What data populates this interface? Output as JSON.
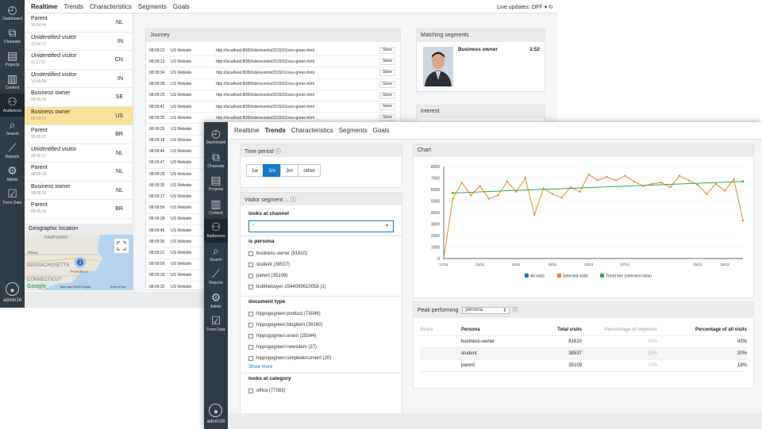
{
  "sidebar": {
    "items": [
      {
        "label": "Dashboard",
        "icon": "gauge-icon"
      },
      {
        "label": "Channels",
        "icon": "channels-icon"
      },
      {
        "label": "Projects",
        "icon": "clipboard-icon"
      },
      {
        "label": "Content",
        "icon": "document-icon"
      },
      {
        "label": "Audiences",
        "icon": "audiences-icon"
      },
      {
        "label": "Search",
        "icon": "search-icon"
      },
      {
        "label": "Reports",
        "icon": "chart-icon"
      },
      {
        "label": "Admin",
        "icon": "gear-icon"
      },
      {
        "label": "Form Data",
        "icon": "checkbox-icon"
      }
    ],
    "user": "admin16"
  },
  "back": {
    "tabs": [
      "Realtime",
      "Trends",
      "Characteristics",
      "Segments",
      "Goals"
    ],
    "live": "Live updates: OFF",
    "visitors": [
      {
        "name": "Parent",
        "time": "14:14:44",
        "country": "NL",
        "italic": false
      },
      {
        "name": "Unidentified visitor",
        "time": "12:04:17",
        "country": "IN",
        "italic": true
      },
      {
        "name": "Unidentified visitor",
        "time": "11:57:37",
        "country": "CN",
        "italic": true
      },
      {
        "name": "Unidentified visitor",
        "time": "10:40:58",
        "country": "IN",
        "italic": true
      },
      {
        "name": "Business owner",
        "time": "08:09:25",
        "country": "SE",
        "italic": false
      },
      {
        "name": "Business owner",
        "time": "08:09:22",
        "country": "US",
        "italic": false
      },
      {
        "name": "Parent",
        "time": "08:05:22",
        "country": "BR",
        "italic": false
      },
      {
        "name": "Unidentified visitor",
        "time": "08:05:17",
        "country": "NL",
        "italic": true
      },
      {
        "name": "Parent",
        "time": "08:05:16",
        "country": "NL",
        "italic": false
      },
      {
        "name": "Business owner",
        "time": "08:05:16",
        "country": "NL",
        "italic": false
      },
      {
        "name": "Parent",
        "time": "08:05:15",
        "country": "BR",
        "italic": false
      }
    ],
    "geo": {
      "title": "Geographic location",
      "labels": [
        "Albany",
        "HAMPSHIRE",
        "MASSACHUSETTS",
        "Providence",
        "CONNECTICUT"
      ],
      "marker": "3",
      "footer": "Map data ©2018 Google",
      "terms": "Terms of Use",
      "google": "Google"
    },
    "journey": {
      "title": "Journey",
      "rows": [
        {
          "time": "08:09:22",
          "site": "US Website",
          "url": "http://localhost:8080/site/events/2015/01/ces-green.html",
          "tag": "Store"
        },
        {
          "time": "08:09:13",
          "site": "US Website",
          "url": "http://localhost:8080/site/events/2015/01/ces-green.html",
          "tag": "Store"
        },
        {
          "time": "08:09:34",
          "site": "US Website",
          "url": "http://localhost:8080/site/events/2015/01/ces-green.html",
          "tag": "Store"
        },
        {
          "time": "08:09:38",
          "site": "US Website",
          "url": "http://localhost:8080/site/events/2015/01/ces-green.html",
          "tag": "Store"
        },
        {
          "time": "08:09:25",
          "site": "US Website",
          "url": "http://localhost:8080/site/events/2015/01/ces-green.html",
          "tag": "Store"
        },
        {
          "time": "08:09:41",
          "site": "US Website",
          "url": "http://localhost:8080/site/events/2015/01/ces-green.html",
          "tag": "Store"
        },
        {
          "time": "08:09:35",
          "site": "US Website",
          "url": "http://localhost:8080/site/events/2015/01/ces-green.html",
          "tag": "Store"
        },
        {
          "time": "08:09:26",
          "site": "US Website",
          "url": "",
          "tag": ""
        },
        {
          "time": "08:09:18",
          "site": "US Website",
          "url": "",
          "tag": ""
        },
        {
          "time": "08:09:46",
          "site": "US Website",
          "url": "",
          "tag": ""
        },
        {
          "time": "08:09:47",
          "site": "US Website",
          "url": "",
          "tag": ""
        },
        {
          "time": "08:09:28",
          "site": "US Website",
          "url": "",
          "tag": ""
        },
        {
          "time": "08:09:35",
          "site": "US Website",
          "url": "",
          "tag": ""
        },
        {
          "time": "08:09:17",
          "site": "US Website",
          "url": "",
          "tag": ""
        },
        {
          "time": "08:09:56",
          "site": "US Website",
          "url": "",
          "tag": ""
        },
        {
          "time": "08:09:28",
          "site": "US Website",
          "url": "",
          "tag": ""
        },
        {
          "time": "08:09:45",
          "site": "US Website",
          "url": "",
          "tag": ""
        },
        {
          "time": "08:09:35",
          "site": "US Website",
          "url": "",
          "tag": ""
        },
        {
          "time": "08:09:21",
          "site": "US Website",
          "url": "",
          "tag": ""
        },
        {
          "time": "08:09:09",
          "site": "US Website",
          "url": "",
          "tag": ""
        },
        {
          "time": "08:09:39",
          "site": "US Website",
          "url": "",
          "tag": ""
        },
        {
          "time": "08:09:32",
          "site": "US Website",
          "url": "",
          "tag": ""
        }
      ]
    },
    "matching": {
      "title": "Matching segments",
      "name": "Business owner",
      "score": "2.52"
    },
    "interest": {
      "title": "Interest"
    }
  },
  "front": {
    "tabs": [
      "Realtime",
      "Trends",
      "Characteristics",
      "Segments",
      "Goals"
    ],
    "time_period": {
      "title": "Time period",
      "options": [
        "1w",
        "1m",
        "3m",
        "other"
      ],
      "selected": "1m"
    },
    "visitor_segment": {
      "title": "Visitor segment ...",
      "channel_title": "looks at channel",
      "channel_value": "-",
      "persona_title": "is persona",
      "personas": [
        "business-owner (81610)",
        "student (38537)",
        "parent (35109)",
        "bobthebuyer-1544099610058 (1)"
      ],
      "doctype_title": "document type",
      "doctypes": [
        "hippogogreen:product (73046)",
        "hippogogreen:blogitem (38160)",
        "hippogogreen:event (29344)",
        "hippogogreen:newsitem (27)",
        "hippogogreen:simpledocument (20)"
      ],
      "show_more": "Show more",
      "category_title": "looks at category",
      "categories": [
        "office (77083)"
      ]
    },
    "chart_title": "Chart",
    "peak": {
      "title": "Peak performing",
      "select": "persona",
      "headers": [
        "Score",
        "Persona",
        "Total visits",
        "Percentage of segment",
        "Percentage of all visits"
      ],
      "rows": [
        {
          "score": "",
          "persona": "business-owner",
          "visits": "81610",
          "seg": "43%",
          "all": "43%"
        },
        {
          "score": "",
          "persona": "student",
          "visits": "38537",
          "seg": "20%",
          "all": "20%"
        },
        {
          "score": "",
          "persona": "parent",
          "visits": "35109",
          "seg": "19%",
          "all": "19%"
        }
      ]
    }
  },
  "chart_data": {
    "type": "line",
    "title": "",
    "x": [
      "17/11",
      "18/11",
      "19/11",
      "20/11",
      "21/11",
      "22/11",
      "23/11",
      "24/11",
      "25/11",
      "26/11",
      "27/11",
      "28/11",
      "29/11",
      "30/11",
      "01/12",
      "02/12",
      "03/12",
      "04/12",
      "05/12",
      "06/12",
      "07/12",
      "08/12",
      "09/12",
      "10/12",
      "11/12",
      "12/12",
      "13/12",
      "14/12",
      "15/12",
      "16/12",
      "17/12",
      "18/12",
      "19/12",
      "20/12"
    ],
    "tick_labels": [
      "17/11",
      "21/11",
      "25/11",
      "29/11",
      "03/12",
      "07/12",
      "15/12",
      "18/12"
    ],
    "ylim": [
      0,
      8000
    ],
    "yticks": [
      "0",
      "1000",
      "2000",
      "3000",
      "4000",
      "5000",
      "6000",
      "7000",
      "8000"
    ],
    "legend_position": "bottom",
    "series": [
      {
        "name": "All visits",
        "color": "#1778c6",
        "values": []
      },
      {
        "name": "Selected visits",
        "color": "#f0872b",
        "values": [
          0,
          5200,
          6600,
          5500,
          6300,
          5200,
          5500,
          6700,
          5800,
          7000,
          3800,
          6100,
          5600,
          5300,
          6200,
          5800,
          7300,
          6800,
          7100,
          6800,
          7200,
          6700,
          6300,
          6500,
          6600,
          6200,
          7200,
          6800,
          6400,
          5600,
          6500,
          5900,
          6900,
          3300
        ]
      },
      {
        "name": "Trend line (selected visits)",
        "color": "#2db34a",
        "values": [
          5700,
          6700
        ]
      }
    ]
  }
}
